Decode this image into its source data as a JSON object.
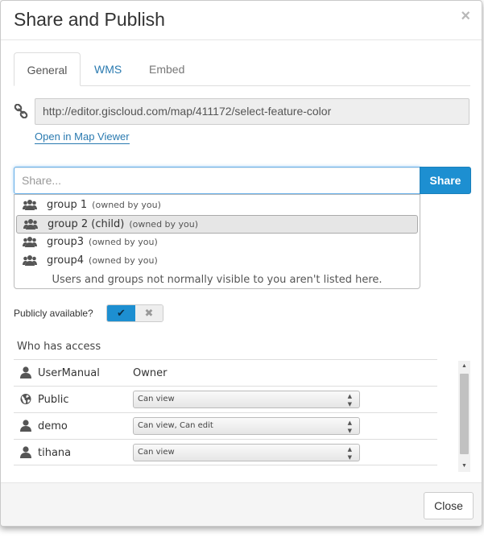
{
  "modal": {
    "title": "Share and Publish",
    "close_glyph": "×"
  },
  "tabs": [
    {
      "label": "General",
      "active": true
    },
    {
      "label": "WMS",
      "active": false
    },
    {
      "label": "Embed",
      "active": false
    }
  ],
  "link": {
    "icon": "link-icon",
    "url": "http://editor.giscloud.com/map/411172/select-feature-color",
    "open_viewer_label": "Open in Map Viewer"
  },
  "share": {
    "placeholder": "Share...",
    "button_label": "Share",
    "dropdown": {
      "items": [
        {
          "name": "group 1",
          "owner": "(owned by you)",
          "icon": "group-icon",
          "selected": false
        },
        {
          "name": "group 2 (child)",
          "owner": "(owned by you)",
          "icon": "group-icon",
          "selected": true
        },
        {
          "name": "group3",
          "owner": "(owned by you)",
          "icon": "group-icon",
          "selected": false
        },
        {
          "name": "group4",
          "owner": "(owned by you)",
          "icon": "group-icon",
          "selected": false
        }
      ],
      "note": "Users and groups not normally visible to you aren't listed here."
    }
  },
  "public": {
    "label": "Publicly available?",
    "on_glyph": "✔",
    "off_glyph": "✖",
    "value": true
  },
  "access": {
    "title": "Who has access",
    "rows": [
      {
        "name": "UserManual",
        "icon": "user-icon",
        "role": "Owner",
        "type": "text"
      },
      {
        "name": "Public",
        "icon": "globe-icon",
        "role": "Can view",
        "type": "select"
      },
      {
        "name": "demo",
        "icon": "user-icon",
        "role": "Can view, Can edit",
        "type": "select"
      },
      {
        "name": "tihana",
        "icon": "user-icon",
        "role": "Can view",
        "type": "select"
      }
    ]
  },
  "footer": {
    "close_label": "Close"
  },
  "colors": {
    "accent": "#1d8fd1",
    "link": "#2a7ab0",
    "footer_bg": "#f5f5f5"
  }
}
